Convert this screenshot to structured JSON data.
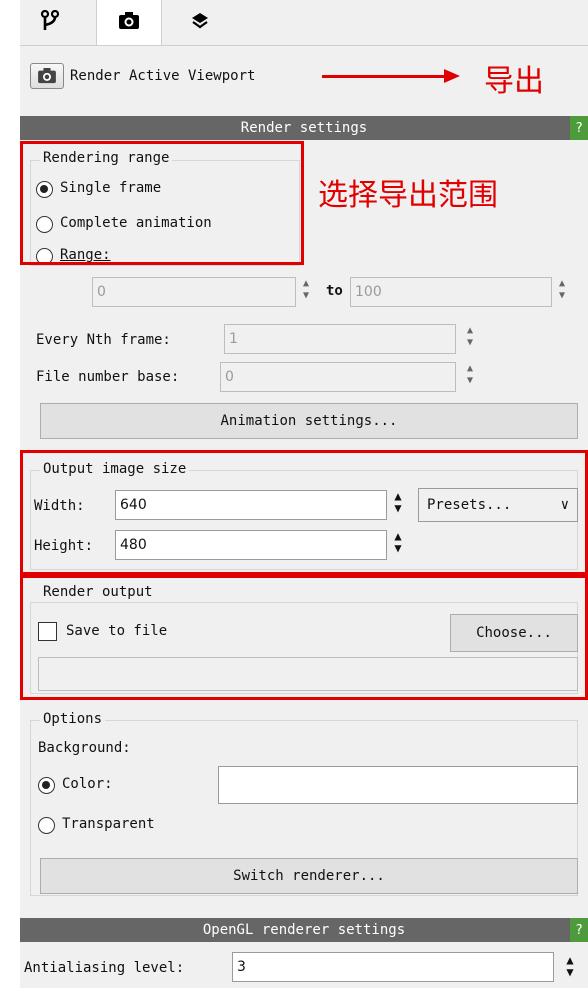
{
  "tabs": [
    {
      "icon": "pipeline-icon",
      "glyph": "⑂"
    },
    {
      "icon": "camera-icon",
      "glyph": "◉"
    },
    {
      "icon": "layers-icon",
      "glyph": "◆"
    }
  ],
  "render_active_viewport": "Render Active Viewport",
  "annotations": {
    "export": "导出",
    "select_range": "选择导出范围"
  },
  "render_settings": {
    "header": "Render settings",
    "help": "?",
    "rendering_range": {
      "title": "Rendering range",
      "options": [
        "Single frame",
        "Complete animation",
        "Range:"
      ],
      "selected": "Single frame"
    },
    "range_from": "0",
    "range_to_label": "to",
    "range_to": "100",
    "every_nth_label": "Every Nth frame:",
    "every_nth_value": "1",
    "file_number_base_label": "File number base:",
    "file_number_base_value": "0",
    "animation_settings_button": "Animation settings..."
  },
  "output_image_size": {
    "title": "Output image size",
    "width_label": "Width:",
    "width_value": "640",
    "height_label": "Height:",
    "height_value": "480",
    "presets_label": "Presets...",
    "presets_arrow": "∨"
  },
  "render_output": {
    "title": "Render output",
    "save_to_file_label": "Save to file",
    "save_to_file_checked": false,
    "choose_button": "Choose...",
    "path_value": ""
  },
  "options": {
    "title": "Options",
    "background_label": "Background:",
    "color_label": "Color:",
    "transparent_label": "Transparent",
    "selected": "Color:",
    "color_value": "#ffffff",
    "switch_renderer_button": "Switch renderer..."
  },
  "opengl": {
    "header": "OpenGL renderer settings",
    "help": "?",
    "antialiasing_label": "Antialiasing level:",
    "antialiasing_value": "3"
  },
  "colors": {
    "annotation_red": "#e00000",
    "header_gray": "#666666",
    "help_green": "#4d9b3a"
  }
}
